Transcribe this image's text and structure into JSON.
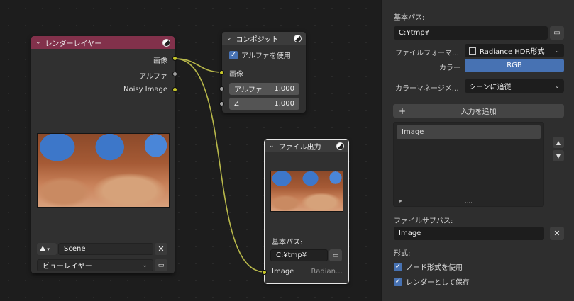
{
  "render_layers_node": {
    "title": "レンダーレイヤー",
    "outputs": [
      "画像",
      "アルファ",
      "Noisy Image"
    ],
    "scene_value": "Scene",
    "view_layer_value": "ビューレイヤー"
  },
  "composite_node": {
    "title": "コンポジット",
    "use_alpha_label": "アルファを使用",
    "input_image_label": "画像",
    "alpha_label": "アルファ",
    "alpha_value": "1.000",
    "z_label": "Z",
    "z_value": "1.000"
  },
  "file_output_node": {
    "title": "ファイル出力",
    "base_path_label": "基本パス:",
    "base_path_value": "C:¥tmp¥",
    "input_image_label": "Image",
    "input_format": "Radian…"
  },
  "side_panel": {
    "base_path_label": "基本パス:",
    "base_path_value": "C:¥tmp¥",
    "file_format_label": "ファイルフォーマ…",
    "file_format_value": "Radiance HDR形式",
    "color_label": "カラー",
    "color_value": "RGB",
    "color_management_label": "カラーマネージメ…",
    "color_management_value": "シーンに追従",
    "add_input_label": "入力を追加",
    "inputs": [
      "Image"
    ],
    "file_subpath_label": "ファイルサブパス:",
    "file_subpath_value": "Image",
    "format_label": "形式:",
    "use_node_format_label": "ノード形式を使用",
    "save_as_render_label": "レンダーとして保存",
    "list_dots": "::::",
    "list_expand": "▸"
  },
  "colors": {
    "render_layer_header": "#82314b",
    "composite_header": "#3c3c3c",
    "socket_yellow": "#c7c729",
    "socket_gray": "#a1a1a1",
    "accent_blue": "#4772b3"
  }
}
